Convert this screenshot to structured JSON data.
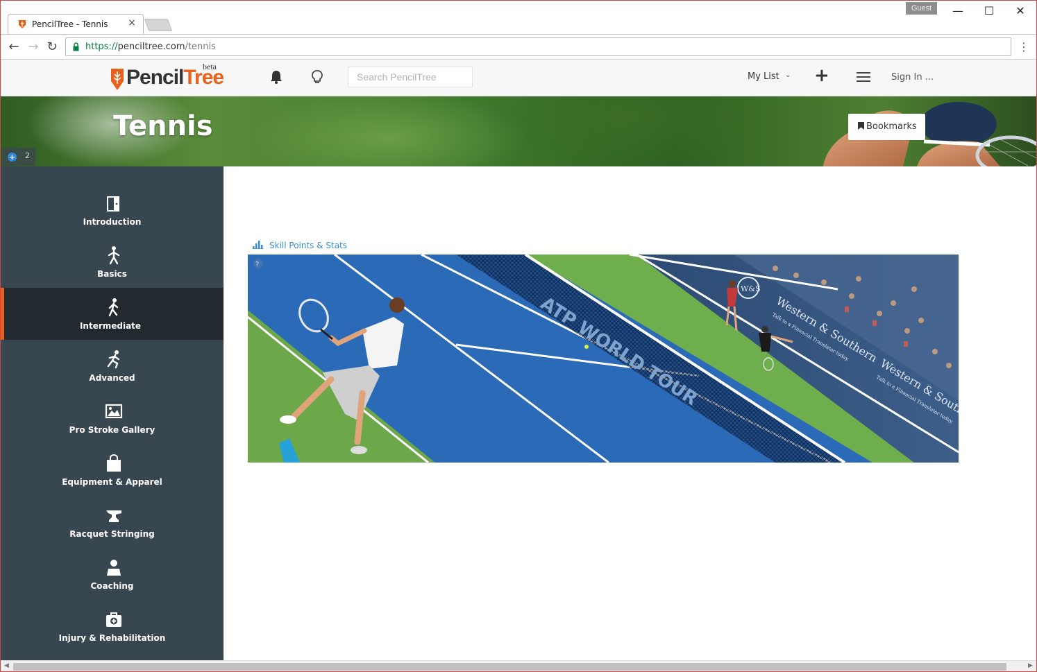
{
  "browser": {
    "tab_title": "PencilTree - Tennis",
    "tab_close": "×",
    "guest_label": "Guest",
    "url_protocol": "https://",
    "url_host": "penciltree.com",
    "url_path": "/tennis",
    "window_controls": {
      "minimize": "—",
      "maximize": "☐",
      "close": "✕"
    },
    "menu": "⋮"
  },
  "header": {
    "logo_part1": "Pencil",
    "logo_part2": "Tree",
    "logo_beta": "beta",
    "search_placeholder": "Search PencilTree",
    "mylist_label": "My List",
    "signin_label": "Sign In ..."
  },
  "banner": {
    "title": "Tennis",
    "badge_count": "2",
    "bookmarks_label": "Bookmarks"
  },
  "sidebar": {
    "items": [
      {
        "label": "Introduction",
        "icon": "door-icon",
        "active": false
      },
      {
        "label": "Basics",
        "icon": "walking-figure-icon",
        "active": false
      },
      {
        "label": "Intermediate",
        "icon": "running-figure-icon",
        "active": true
      },
      {
        "label": "Advanced",
        "icon": "sprinting-figure-icon",
        "active": false
      },
      {
        "label": "Pro Stroke Gallery",
        "icon": "gallery-icon",
        "active": false
      },
      {
        "label": "Equipment & Apparel",
        "icon": "shopping-bag-icon",
        "active": false
      },
      {
        "label": "Racquet Stringing",
        "icon": "anvil-icon",
        "active": false
      },
      {
        "label": "Coaching",
        "icon": "coach-icon",
        "active": false
      },
      {
        "label": "Injury & Rehabilitation",
        "icon": "medical-kit-icon",
        "active": false
      }
    ]
  },
  "content": {
    "skill_link_label": "Skill Points & Stats",
    "image_text": {
      "net_banner": "ATP WORLD TOUR",
      "sponsor": "Western & Southern",
      "sponsor_tagline": "Talk to a Financial Translator today.",
      "sponsor_logo": "W&S"
    }
  },
  "colors": {
    "accent": "#e8601c",
    "sidebar_bg": "#384650",
    "sidebar_active_bg": "#222a30",
    "link": "#3a8fd4",
    "court_blue": "#2b6ab7",
    "court_green": "#6ca84a"
  }
}
